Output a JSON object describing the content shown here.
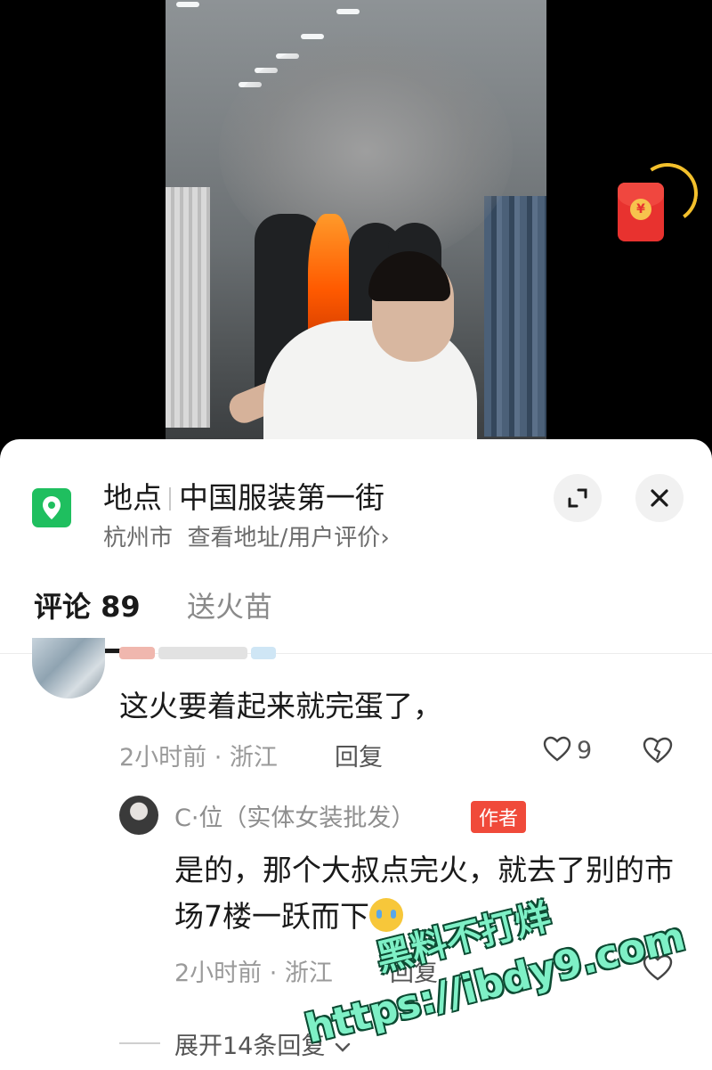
{
  "location": {
    "label": "地点",
    "name": "中国服装第一街",
    "city": "杭州市",
    "link": "查看地址/用户评价",
    "link_chevron": "›"
  },
  "tabs": [
    {
      "label": "评论 89",
      "active": true
    },
    {
      "label": "送火苗",
      "active": false
    }
  ],
  "comments": [
    {
      "text": "这火要着起来就完蛋了，",
      "meta": "2小时前 · 浙江",
      "reply_label": "回复",
      "likes": "9",
      "replies": [
        {
          "user": "C·位（实体女装批发）",
          "badge": "作者",
          "text": "是的，那个大叔点完火，就去了别的市场7楼一跃而下",
          "meta": "2小时前 · 浙江",
          "reply_label": "回复"
        }
      ],
      "expand_label": "展开14条回复"
    }
  ],
  "watermark": {
    "line1": "黑料不打烊",
    "line2": "https://ibdy9.com"
  },
  "colors": {
    "location_icon": "#1fbf5f",
    "author_badge": "#f04a3a",
    "red_packet": "#e8322f",
    "watermark": "#7ef0c6"
  },
  "icons": {
    "location": "map-pin-icon",
    "expand": "expand-icon",
    "close": "close-icon",
    "like": "heart-icon",
    "dislike": "broken-heart-icon",
    "expand_replies": "chevron-down-icon",
    "red_packet": "red-envelope-icon"
  }
}
